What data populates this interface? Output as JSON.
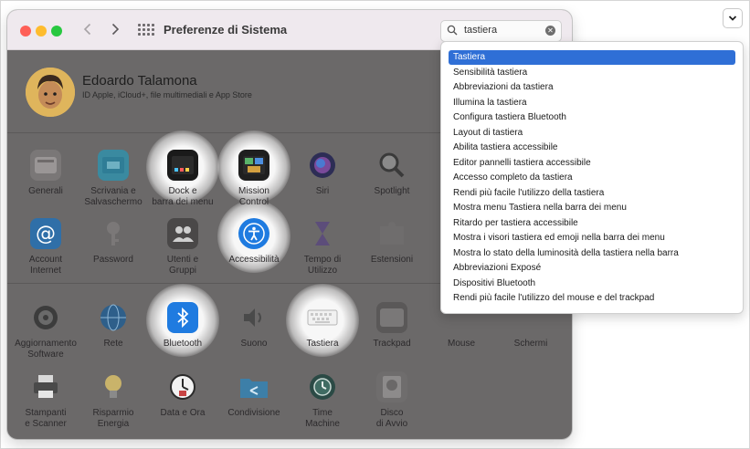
{
  "window": {
    "title": "Preferenze di Sistema"
  },
  "search": {
    "query": "tastiera"
  },
  "user": {
    "name": "Edoardo Talamona",
    "subtitle": "ID Apple, iCloud+, file multimediali e App Store"
  },
  "prefs": {
    "generali": "Generali",
    "scrivania": "Scrivania e\nSalvaschermo",
    "dock": "Dock e\nbarra dei menu",
    "mission": "Mission\nControl",
    "siri": "Siri",
    "spotlight": "Spotlight",
    "account": "Account\nInternet",
    "password": "Password",
    "utenti": "Utenti e\nGruppi",
    "accessibilita": "Accessibilità",
    "tempo": "Tempo di\nUtilizzo",
    "estensioni": "Estensioni",
    "aggiornamento": "Aggiornamento\nSoftware",
    "rete": "Rete",
    "bluetooth": "Bluetooth",
    "suono": "Suono",
    "tastiera": "Tastiera",
    "trackpad": "Trackpad",
    "mouse": "Mouse",
    "schermi": "Schermi",
    "stampanti": "Stampanti\ne Scanner",
    "risparmio": "Risparmio\nEnergia",
    "data": "Data e Ora",
    "condivisione": "Condivisione",
    "timemachine": "Time\nMachine",
    "disco": "Disco\ndi Avvio"
  },
  "suggestions": [
    "Tastiera",
    "Sensibilità tastiera",
    "Abbreviazioni da tastiera",
    "Illumina la tastiera",
    "Configura tastiera Bluetooth",
    "Layout di tastiera",
    "Abilita tastiera accessibile",
    "Editor pannelli tastiera accessibile",
    "Accesso completo da tastiera",
    "Rendi più facile l'utilizzo della tastiera",
    "Mostra menu Tastiera nella barra dei menu",
    "Ritardo per tastiera accessibile",
    "Mostra i visori tastiera ed emoji nella barra dei menu",
    "Mostra lo stato della luminosità della tastiera nella barra",
    "Abbreviazioni Exposé",
    "Dispositivi Bluetooth",
    "Rendi più facile l'utilizzo del mouse e del trackpad"
  ],
  "colors": {
    "selection": "#2f6fd6",
    "dim_overlay": "#6b6969"
  }
}
